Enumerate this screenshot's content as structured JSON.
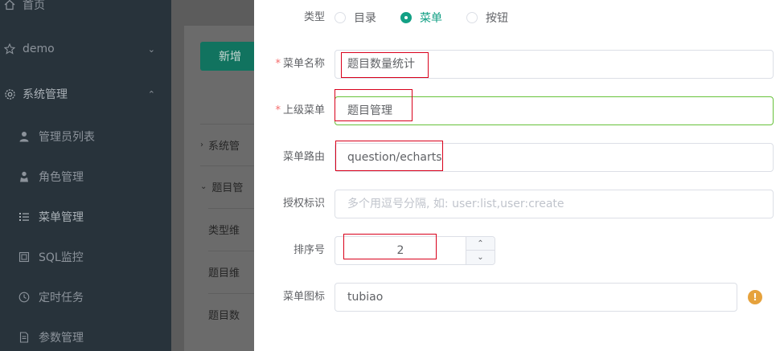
{
  "sidebar": {
    "items": [
      {
        "label": "首页",
        "icon": "home-icon"
      },
      {
        "label": "demo",
        "icon": "star-icon",
        "chevron": "⌄"
      },
      {
        "label": "系统管理",
        "icon": "gear-icon",
        "chevron": "⌃"
      },
      {
        "label": "管理员列表",
        "icon": "user-icon"
      },
      {
        "label": "角色管理",
        "icon": "role-icon"
      },
      {
        "label": "菜单管理",
        "icon": "menu-list-icon"
      },
      {
        "label": "SQL监控",
        "icon": "monitor-icon"
      },
      {
        "label": "定时任务",
        "icon": "clock-icon"
      },
      {
        "label": "参数管理",
        "icon": "document-icon"
      }
    ]
  },
  "content": {
    "new_button": "新增",
    "rows": [
      {
        "label": "系统管",
        "caret": "›"
      },
      {
        "label": "题目管",
        "caret": "⌄"
      },
      {
        "label": "类型维"
      },
      {
        "label": "题目维"
      },
      {
        "label": "题目数"
      }
    ]
  },
  "dialog": {
    "type": {
      "label": "类型",
      "options": [
        "目录",
        "菜单",
        "按钮"
      ],
      "selected": "菜单"
    },
    "menu_name": {
      "label": "菜单名称",
      "value": "题目数量统计"
    },
    "parent_menu": {
      "label": "上级菜单",
      "value": "题目管理"
    },
    "route": {
      "label": "菜单路由",
      "value": "question/echarts"
    },
    "perms": {
      "label": "授权标识",
      "placeholder": "多个用逗号分隔, 如: user:list,user:create"
    },
    "order": {
      "label": "排序号",
      "value": "2",
      "up": "⌃",
      "down": "⌄"
    },
    "icon_field": {
      "label": "菜单图标",
      "value": "tubiao",
      "warn": "!"
    },
    "required_mark": "*"
  },
  "colors": {
    "accent": "#13a085",
    "success_border": "#67c23a",
    "required": "#f56c6c",
    "warning": "#e6a23c",
    "highlight_box": "#d9001b"
  }
}
